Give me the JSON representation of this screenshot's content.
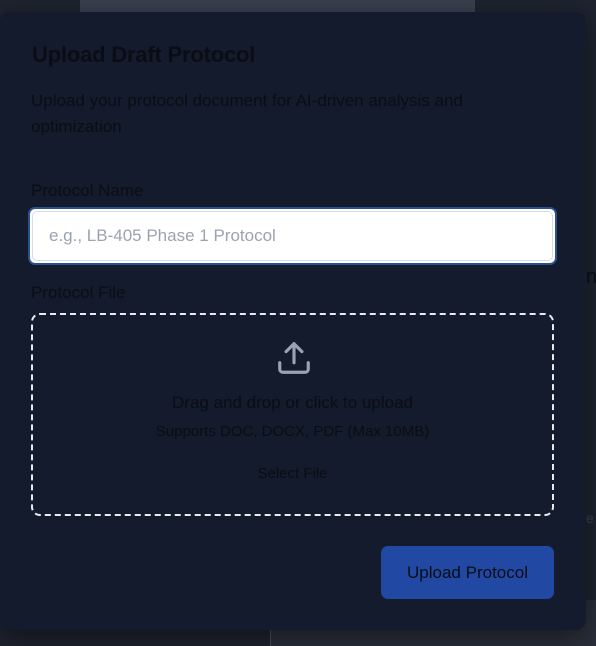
{
  "modal": {
    "title": "Upload Draft Protocol",
    "description": "Upload your protocol document for AI-driven analysis and optimization"
  },
  "form": {
    "name_label": "Protocol Name",
    "name_value": "",
    "name_placeholder": "e.g., LB-405 Phase 1 Protocol",
    "file_label": "Protocol File"
  },
  "dropzone": {
    "icon": "upload-icon",
    "title": "Drag and drop or click to upload",
    "subtitle": "Supports DOC, DOCX, PDF (Max 10MB)",
    "select_label": "Select File"
  },
  "actions": {
    "submit_label": "Upload Protocol"
  },
  "background": {
    "fragment_1": "n",
    "fragment_2": "e"
  },
  "colors": {
    "modal_bg": "#141b2c",
    "accent": "#2148a3",
    "focus_ring": "#2c4f8f"
  }
}
